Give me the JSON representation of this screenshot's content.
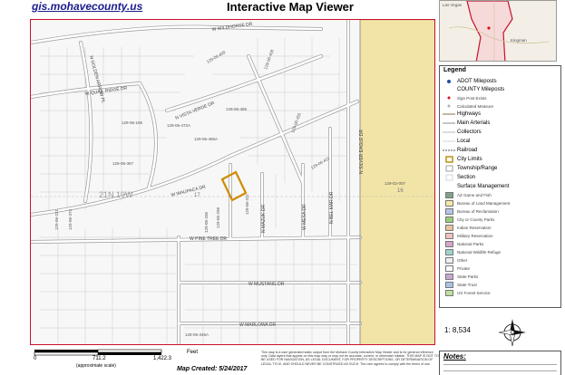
{
  "header": {
    "site_link": "gis.mohavecounty.us",
    "title": "Interactive Map Viewer"
  },
  "map": {
    "streets": {
      "wildhorse": "W WILDHORSE DR",
      "quail_ridge": "W QUAIL RIDGE DR",
      "golden_arrow": "N GOLDEN ARROW PL",
      "vista_verde": "N VISTA VERDE DR",
      "waupaca": "W WAUPACA DR",
      "pine_tree": "W PINE TREE DR",
      "mustang": "W MUSTANG DR",
      "marlowa": "W MARLOWA DR",
      "silver_eagle": "N SILVER EAGLE DR",
      "bel_mar": "N BEL MAR DR",
      "mazuk": "N MAZUK DR",
      "mesa": "W MESA DR"
    },
    "parcels": {
      "p1": "129-06-409",
      "p2": "129-06-408",
      "p3": "129-06-472A",
      "p4": "129-06-465",
      "p5": "129-06-465A",
      "p6": "129-06-156",
      "p7": "129-06-367",
      "p8": "129-06-455",
      "p9": "129-06-411",
      "p10": "129-02-007",
      "p11": "129-06-346A",
      "p12": "129-06-298",
      "p13": "129-06-336",
      "p14": "129-06-221",
      "p15": "129-06-372",
      "p16": "129-06-311"
    },
    "grid_labels": {
      "twn": "21N 19W",
      "sec17": "17",
      "sec16": "16"
    }
  },
  "inset": {
    "label_las_vegas": "Las Vegas",
    "label_kingman": "Kingman"
  },
  "legend": {
    "title": "Legend",
    "items": [
      {
        "label": "ADOT Mileposts",
        "sub": false
      },
      {
        "label": "COUNTY Mileposts",
        "sub": false
      },
      {
        "label": "Sign Post Exists",
        "sub": true
      },
      {
        "label": "Calculated Measure",
        "sub": true
      },
      {
        "label": "Highways",
        "sub": false
      },
      {
        "label": "Main Arterials",
        "sub": false
      },
      {
        "label": "Collectors",
        "sub": false
      },
      {
        "label": "Local",
        "sub": false
      },
      {
        "label": "Railroad",
        "sub": false
      },
      {
        "label": "City Limits",
        "sub": false
      },
      {
        "label": "Township/Range",
        "sub": false
      },
      {
        "label": "Section",
        "sub": false
      },
      {
        "label": "Surface Management",
        "sub": false
      },
      {
        "label": "AZ Game and Fish",
        "sub": true
      },
      {
        "label": "Bureau of Land Management",
        "sub": true
      },
      {
        "label": "Bureau of Reclamation",
        "sub": true
      },
      {
        "label": "City or County Parks",
        "sub": true
      },
      {
        "label": "Indian Reservation",
        "sub": true
      },
      {
        "label": "Military Reservation",
        "sub": true
      },
      {
        "label": "National Parks",
        "sub": true
      },
      {
        "label": "National Wildlife Refuge",
        "sub": true
      },
      {
        "label": "Other",
        "sub": true
      },
      {
        "label": "Private",
        "sub": true
      },
      {
        "label": "State Parks",
        "sub": true
      },
      {
        "label": "State Trust",
        "sub": true
      },
      {
        "label": "US Forest Service",
        "sub": true
      }
    ],
    "colors": {
      "adot": "#1f4e9c",
      "sign_post": "#d4141a",
      "calculated": "#b0b0b0",
      "city_limits": "#b58900",
      "az_game": "#7fa48a",
      "blm": "#f5e7a6",
      "bor": "#b3c6e7",
      "parks": "#9acd7a",
      "indian": "#e8c39e",
      "military": "#f2c1c1",
      "natl_parks": "#d4a6c8",
      "wildlife": "#9ed4c9",
      "other": "#eeeeee",
      "private": "#ffffff",
      "state_parks": "#c9a6d4",
      "state_trust": "#a9c4e3",
      "forest": "#bfe0a0"
    }
  },
  "scale": {
    "ratio": "1: 8,534",
    "ticks": [
      "0",
      "711.2",
      "1,422.3"
    ],
    "unit": "Feet",
    "projection": "(approximate scale)"
  },
  "footer": {
    "map_created": "Map Created: 5/24/2017",
    "disclaimer": "This map is a user generated static output from the Mohave County Interactive Map Viewer and is for general reference only. Data layers that appear on this map may or may not be accurate, current, or otherwise reliable. THIS MAP IS NOT TO BE USED FOR NAVIGATION, AS LEGAL DOCUMENT, FOR PROPERTY DESCRIPTIONS, OR DETERMINATION OF LEGAL TITLE, AND SHOULD NEVER BE CONSTRUED AS SUCH. The user agrees to comply with the terms of use.",
    "notes_label": "Notes:"
  }
}
